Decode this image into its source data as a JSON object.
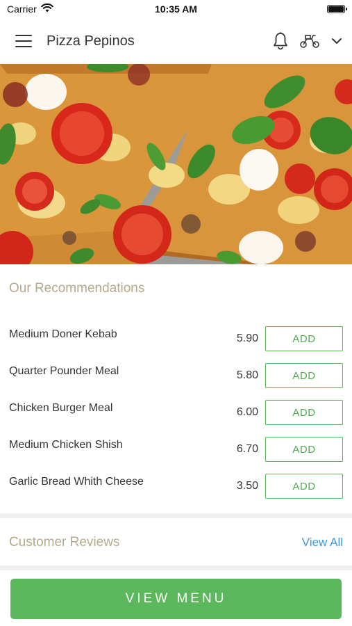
{
  "status_bar": {
    "carrier": "Carrier",
    "time": "10:35 AM"
  },
  "nav": {
    "title": "Pizza Pepinos",
    "icons": [
      "menu-icon",
      "bell-icon",
      "scooter-icon",
      "chevron-down-icon"
    ]
  },
  "hero": {
    "image": "pizza-photo"
  },
  "recommendations": {
    "title": "Our Recommendations",
    "items": [
      {
        "name": "Medium Doner Kebab",
        "price": "5.90",
        "button": "ADD"
      },
      {
        "name": "Quarter Pounder Meal",
        "price": "5.80",
        "button": "ADD"
      },
      {
        "name": "Chicken Burger Meal",
        "price": "6.00",
        "button": "ADD"
      },
      {
        "name": "Medium Chicken Shish",
        "price": "6.70",
        "button": "ADD"
      },
      {
        "name": "Garlic Bread Whith Cheese",
        "price": "3.50",
        "button": "ADD"
      }
    ]
  },
  "reviews": {
    "title": "Customer Reviews",
    "link": "View All"
  },
  "footer": {
    "button": "VIEW MENU"
  },
  "colors": {
    "accent_green": "#5cb85c",
    "section_title": "#b3a98c",
    "link_blue": "#3a9ad9"
  }
}
